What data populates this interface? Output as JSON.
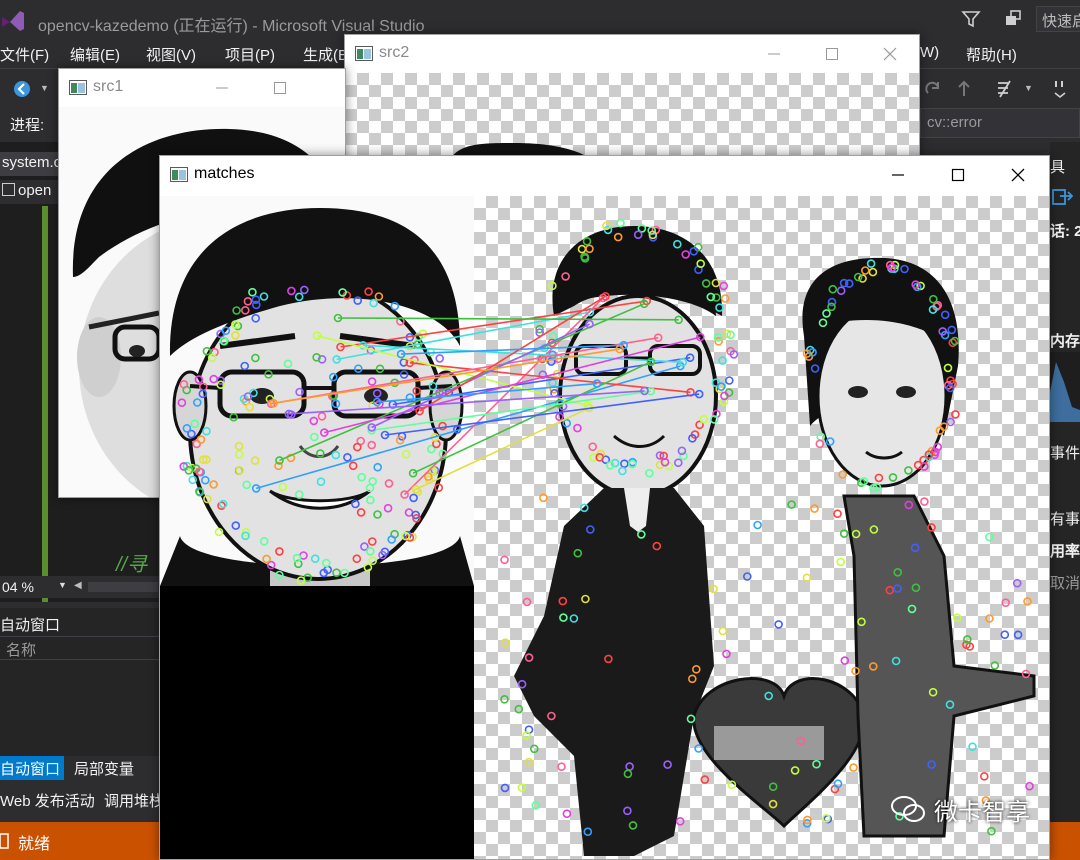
{
  "vs": {
    "title": "opencv-kazedemo (正在运行) - Microsoft Visual Studio",
    "quick_launch": "快速启",
    "menu": [
      "文件(F)",
      "编辑(E)",
      "视图(V)",
      "项目(P)",
      "生成(B",
      "W)",
      "帮助(H)"
    ],
    "process_label": "进程:",
    "error_dropdown": "cv::error",
    "editor_tabs": [
      "system.c",
      "open"
    ],
    "code_comment": "//寻",
    "zoom": "04 %",
    "autos_title": "自动窗口",
    "autos_column_name": "名称",
    "bottom_tabs": [
      "自动窗口",
      "局部变量",
      "Web 发布活动",
      "调用堆栈"
    ],
    "status": "就绪",
    "right_panel": {
      "tools": "具",
      "session": "话: 2",
      "memory": "内存",
      "events": "事件",
      "all_events": "有事",
      "usage": "用率",
      "cancel": "取消"
    },
    "accent_color": "#007acc",
    "status_color": "#ca5100"
  },
  "windows": {
    "src1": {
      "title": "src1"
    },
    "src2": {
      "title": "src2"
    },
    "matches": {
      "title": "matches"
    }
  },
  "watermark": {
    "text": "微卡智享"
  }
}
